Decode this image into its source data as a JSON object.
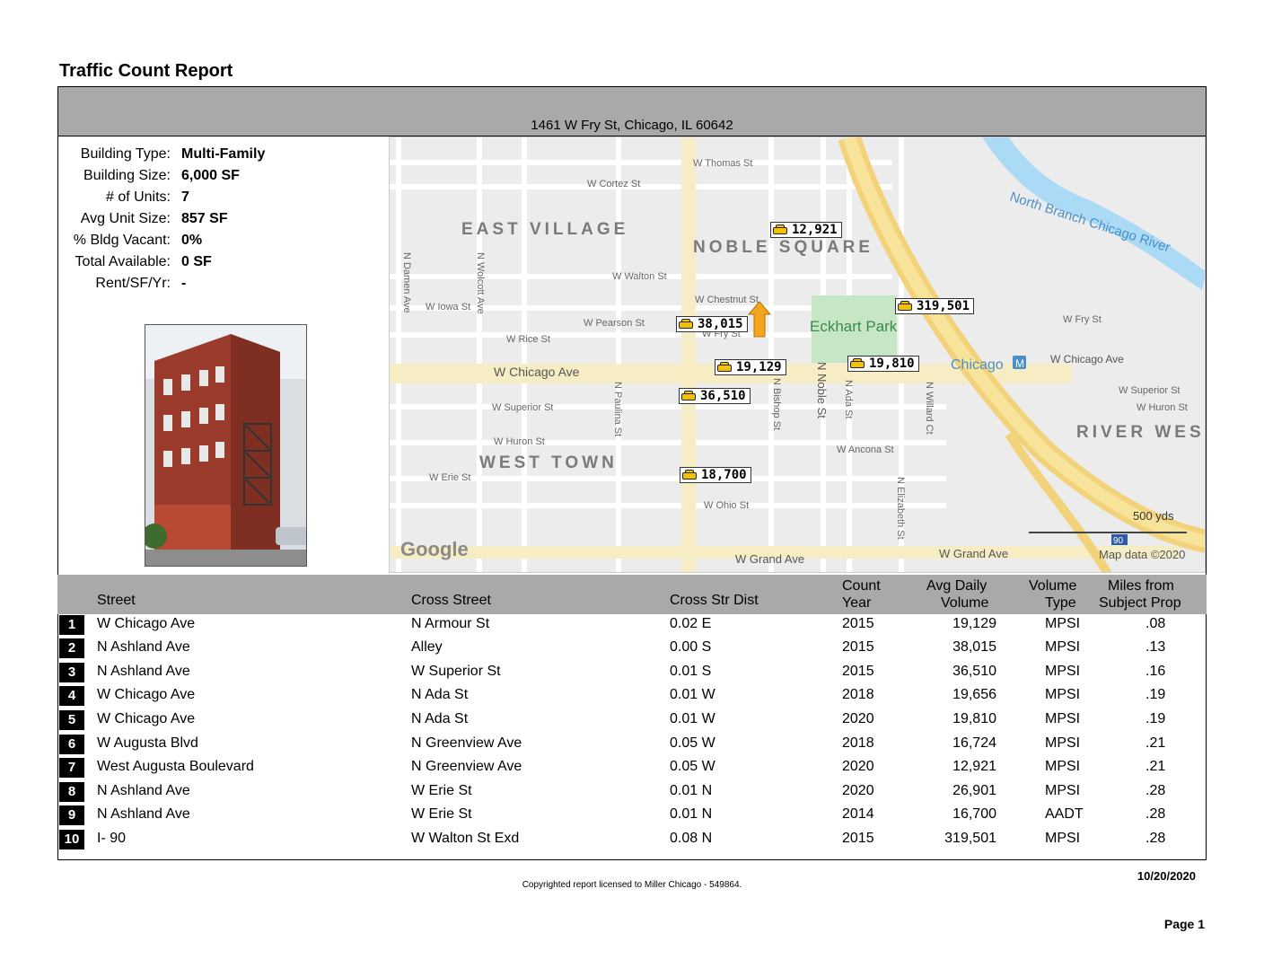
{
  "report_title": "Traffic Count Report",
  "address": "1461 W Fry St, Chicago, IL 60642",
  "building_info": [
    {
      "label": "Building Type:",
      "value": "Multi-Family"
    },
    {
      "label": "Building Size:",
      "value": "6,000 SF"
    },
    {
      "label": "# of Units:",
      "value": "7"
    },
    {
      "label": "Avg Unit Size:",
      "value": "857 SF"
    },
    {
      "label": "% Bldg Vacant:",
      "value": "0%"
    },
    {
      "label": "Total Available:",
      "value": "0 SF"
    },
    {
      "label": "Rent/SF/Yr:",
      "value": "-"
    }
  ],
  "map": {
    "neighborhoods": [
      "EAST VILLAGE",
      "NOBLE SQUARE",
      "WEST TOWN",
      "RIVER WES"
    ],
    "park": "Eckhart Park",
    "river": "North Branch Chicago River",
    "station": "Chicago",
    "station_icon": "metro-icon",
    "streets": [
      "W Thomas St",
      "W Cortez St",
      "W Walton St",
      "W Iowa St",
      "W Chestnut St",
      "W Pearson St",
      "W Fry St",
      "W Rice St",
      "W Chicago Ave",
      "W Superior St",
      "W Huron St",
      "W Erie St",
      "W Ohio St",
      "W Grand Ave",
      "W Ancona St",
      "N Damen Ave",
      "N Wolcott Ave",
      "N Paulina St",
      "N Bishop St",
      "N Noble St",
      "N Ada St",
      "N Willard Ct",
      "N Elizabeth St",
      "W Fry St",
      "W Chicago Ave",
      "W Superior St",
      "W Huron St",
      "W Grand Ave"
    ],
    "counts": [
      "12,921",
      "319,501",
      "38,015",
      "19,129",
      "19,810",
      "36,510",
      "18,700"
    ],
    "scale": "500 yds",
    "shield": "90",
    "attribution": "Map data ©2020",
    "logo": "Google"
  },
  "table": {
    "headers": {
      "street": "Street",
      "cross_street": "Cross Street",
      "cross_dist": "Cross Str Dist",
      "count_year_1": "Count",
      "count_year_2": "Year",
      "adv_1": "Avg Daily",
      "adv_2": "Volume",
      "vol_1": "Volume",
      "vol_2": "Type",
      "miles_1": "Miles from",
      "miles_2": "Subject Prop"
    },
    "rows": [
      {
        "n": "1",
        "street": "W Chicago Ave",
        "cross": "N Armour St",
        "dist": "0.02 E",
        "year": "2015",
        "volume": "19,129",
        "type": "MPSI",
        "miles": ".08"
      },
      {
        "n": "2",
        "street": "N Ashland Ave",
        "cross": "Alley",
        "dist": "0.00 S",
        "year": "2015",
        "volume": "38,015",
        "type": "MPSI",
        "miles": ".13"
      },
      {
        "n": "3",
        "street": "N Ashland Ave",
        "cross": "W Superior St",
        "dist": "0.01 S",
        "year": "2015",
        "volume": "36,510",
        "type": "MPSI",
        "miles": ".16"
      },
      {
        "n": "4",
        "street": "W Chicago Ave",
        "cross": "N Ada St",
        "dist": "0.01 W",
        "year": "2018",
        "volume": "19,656",
        "type": "MPSI",
        "miles": ".19"
      },
      {
        "n": "5",
        "street": "W Chicago Ave",
        "cross": "N Ada St",
        "dist": "0.01 W",
        "year": "2020",
        "volume": "19,810",
        "type": "MPSI",
        "miles": ".19"
      },
      {
        "n": "6",
        "street": "W Augusta Blvd",
        "cross": "N Greenview Ave",
        "dist": "0.05 W",
        "year": "2018",
        "volume": "16,724",
        "type": "MPSI",
        "miles": ".21"
      },
      {
        "n": "7",
        "street": "West Augusta Boulevard",
        "cross": "N Greenview Ave",
        "dist": "0.05 W",
        "year": "2020",
        "volume": "12,921",
        "type": "MPSI",
        "miles": ".21"
      },
      {
        "n": "8",
        "street": "N Ashland Ave",
        "cross": "W Erie St",
        "dist": "0.01 N",
        "year": "2020",
        "volume": "26,901",
        "type": "MPSI",
        "miles": ".28"
      },
      {
        "n": "9",
        "street": "N Ashland Ave",
        "cross": "W Erie St",
        "dist": "0.01 N",
        "year": "2014",
        "volume": "16,700",
        "type": "AADT",
        "miles": ".28"
      },
      {
        "n": "10",
        "street": "I- 90",
        "cross": "W Walton St Exd",
        "dist": "0.08 N",
        "year": "2015",
        "volume": "319,501",
        "type": "MPSI",
        "miles": ".28"
      }
    ]
  },
  "date": "10/20/2020",
  "copyright": "Copyrighted report licensed to Miller Chicago - 549864.",
  "page": "Page 1"
}
